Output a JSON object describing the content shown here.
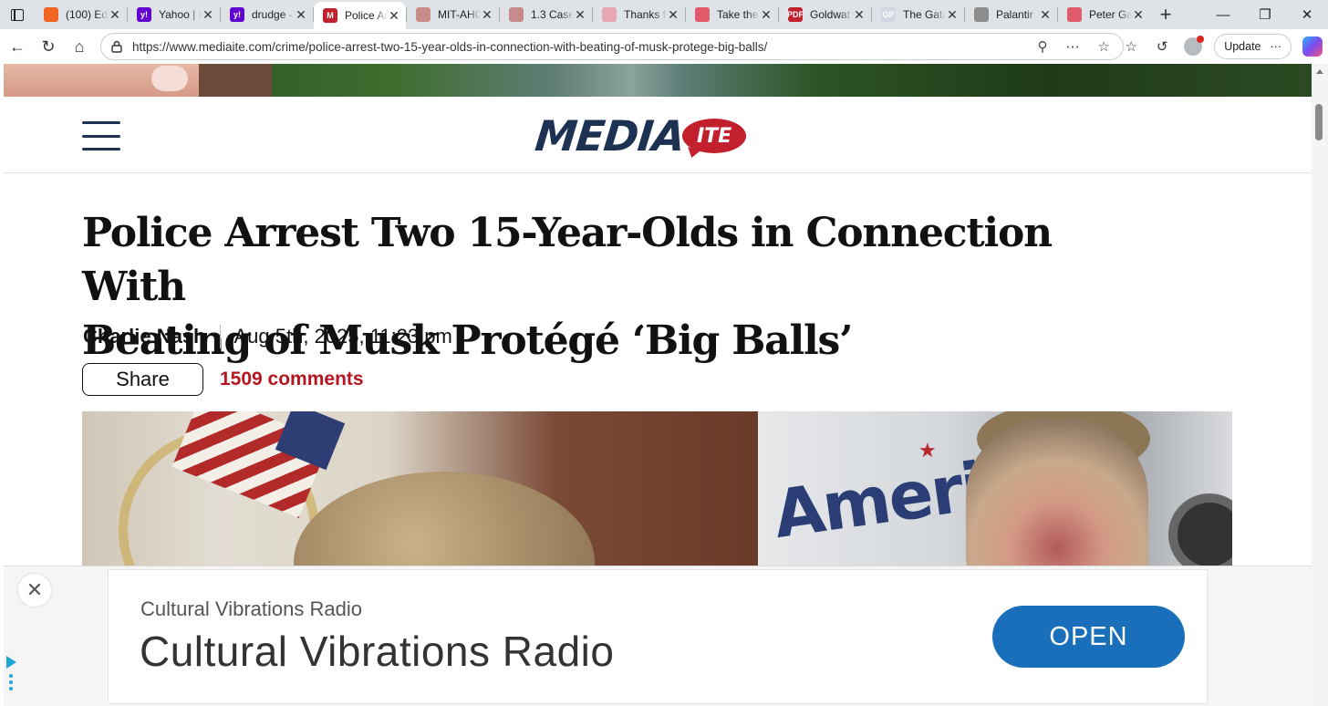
{
  "tabs": [
    {
      "title": "(100) Ed",
      "favicon_text": "",
      "favicon_color": "#f26522"
    },
    {
      "title": "Yahoo | I",
      "favicon_text": "y!",
      "favicon_color": "#6001d2"
    },
    {
      "title": "drudge -",
      "favicon_text": "y!",
      "favicon_color": "#6001d2"
    },
    {
      "title": "Police Ar",
      "favicon_text": "M",
      "favicon_color": "#c2202c",
      "active": true
    },
    {
      "title": "MIT-AHC",
      "favicon_text": "",
      "favicon_color": "#c88a8a"
    },
    {
      "title": "1.3 Case",
      "favicon_text": "",
      "favicon_color": "#c88a8a"
    },
    {
      "title": "Thanks f",
      "favicon_text": "",
      "favicon_color": "#e9a7b4"
    },
    {
      "title": "Take the",
      "favicon_text": "",
      "favicon_color": "#e05a6a"
    },
    {
      "title": "Goldwat",
      "favicon_text": "PDF",
      "favicon_color": "#c2202c"
    },
    {
      "title": "The Gatu",
      "favicon_text": "GP",
      "favicon_color": "#cfd8e3"
    },
    {
      "title": "Palantir",
      "favicon_text": "",
      "favicon_color": "#8c8c8c"
    },
    {
      "title": "Peter Ga",
      "favicon_text": "",
      "favicon_color": "#e05a6a"
    }
  ],
  "toolbar": {
    "url": "https://www.mediaite.com/crime/police-arrest-two-15-year-olds-in-connection-with-beating-of-musk-protege-big-balls/",
    "update_label": "Update"
  },
  "site": {
    "logo_main": "MEDIA",
    "logo_accent": "ITE",
    "brand_navy": "#1d3153",
    "brand_red": "#c2202c"
  },
  "article": {
    "headline_line1": "Police Arrest Two 15-Year-Olds in Connection With",
    "headline_line2": "Beating of Musk Protégé ‘Big Balls’",
    "author": "Charlie Nash",
    "date": "Aug 5th, 2025, 11:23 pm",
    "share_label": "Share",
    "comments": "1509 comments",
    "hero_right_brand": "American"
  },
  "ad": {
    "subtitle": "Cultural Vibrations Radio",
    "title": "Cultural Vibrations Radio",
    "cta": "OPEN",
    "cta_color": "#1a6fba"
  }
}
